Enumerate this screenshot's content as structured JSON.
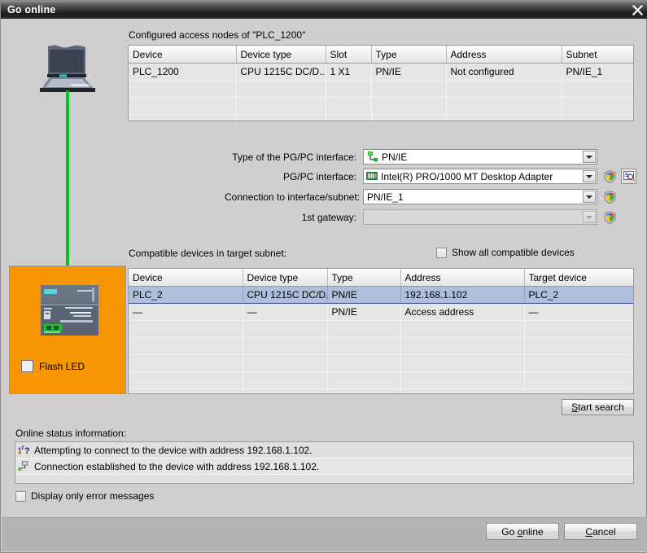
{
  "window": {
    "title": "Go online",
    "close_icon": "close-icon"
  },
  "access_nodes": {
    "caption": "Configured access nodes of \"PLC_1200\"",
    "columns": [
      "Device",
      "Device type",
      "Slot",
      "Type",
      "Address",
      "Subnet"
    ],
    "rows": [
      [
        "PLC_1200",
        "CPU 1215C DC/D...",
        "1 X1",
        "PN/IE",
        "Not configured",
        "PN/IE_1"
      ]
    ],
    "empty_rows": 3
  },
  "interface_form": {
    "type_label": "Type of the PG/PC interface:",
    "type_value": "PN/IE",
    "type_icon": "network-node-icon",
    "pgpc_label": "PG/PC interface:",
    "pgpc_value": "Intel(R) PRO/1000 MT Desktop Adapter",
    "pgpc_icon": "network-card-icon",
    "connection_label": "Connection to interface/subnet:",
    "connection_value": "PN/IE_1",
    "gateway_label": "1st gateway:",
    "gateway_value": "",
    "gateway_disabled": true,
    "shield_icon": "uac-shield-icon",
    "properties_icon": "interface-properties-icon"
  },
  "compatible": {
    "caption": "Compatible devices in target subnet:",
    "show_all_label": "Show all compatible devices",
    "show_all_checked": false,
    "columns": [
      "Device",
      "Device type",
      "Type",
      "Address",
      "Target device"
    ],
    "rows": [
      {
        "cells": [
          "PLC_2",
          "CPU 1215C DC/D...",
          "PN/IE",
          "192.168.1.102",
          "PLC_2"
        ],
        "selected": true
      },
      {
        "cells": [
          "—",
          "—",
          "PN/IE",
          "Access address",
          "—"
        ],
        "selected": false
      }
    ],
    "empty_rows": 5,
    "start_search_label_pre": "",
    "start_search_accel": "S",
    "start_search_label_post": "tart search"
  },
  "device_panel": {
    "flash_led_label": "Flash LED",
    "flash_led_checked": false,
    "plc_image": "plc-device-image",
    "laptop_image": "laptop-image",
    "cable_color": "#00c425",
    "panel_color": "#f79503"
  },
  "status": {
    "caption": "Online status information:",
    "messages": [
      {
        "icon": "searching-node-icon",
        "text": "Attempting to connect to the device with address 192.168.1.102."
      },
      {
        "icon": "connected-node-icon",
        "text": "Connection established to the device with address 192.168.1.102."
      }
    ],
    "display_errors_label": "Display only error messages",
    "display_errors_checked": false
  },
  "footer": {
    "go_online_pre": "Go ",
    "go_online_accel": "o",
    "go_online_post": "nline",
    "cancel_accel": "C",
    "cancel_post": "ancel"
  },
  "colors": {
    "accent_selection": "#aebfdc",
    "selection_border": "#3a55a0",
    "panel_orange": "#f79503",
    "cable_green": "#00c425",
    "dialog_bg": "#cfcfcf",
    "table_bg": "#e0e0e0"
  }
}
